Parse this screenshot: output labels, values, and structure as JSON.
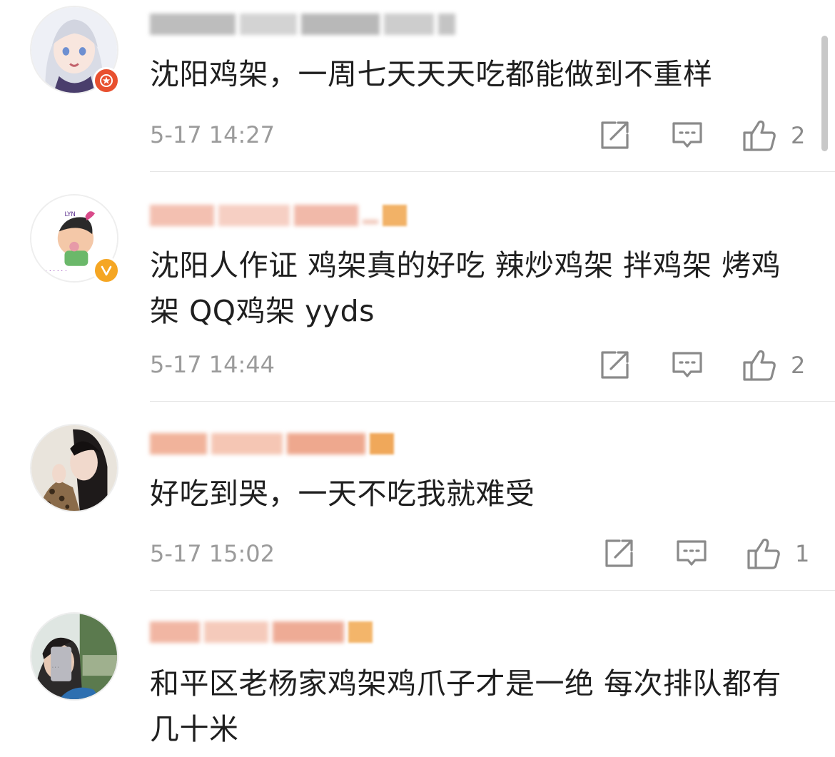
{
  "comments": [
    {
      "text": "沈阳鸡架，一周七天天天吃都能做到不重样",
      "time": "5-17 14:27",
      "likes": "2",
      "badge": {
        "type": "star-badge",
        "color": "#e8502f"
      },
      "name_colors": [
        "#bfbfbf",
        "#d2d2d2",
        "#b5b5b5"
      ]
    },
    {
      "text": "沈阳人作证 鸡架真的好吃 辣炒鸡架 拌鸡架 烤鸡架 QQ鸡架 yyds",
      "time": "5-17 14:44",
      "likes": "2",
      "badge": {
        "type": "verified-v-badge",
        "color": "#f5a623"
      },
      "name_colors": [
        "#f3c2b4",
        "#f7d2c7",
        "#f0b8a8"
      ]
    },
    {
      "text": "好吃到哭，一天不吃我就难受",
      "time": "5-17 15:02",
      "likes": "1",
      "name_colors": [
        "#f2b49c",
        "#f6c9b7",
        "#efa98e"
      ]
    },
    {
      "text": "和平区老杨家鸡架鸡爪子才是一绝 每次排队都有几十米",
      "name_colors": [
        "#f2b7a4",
        "#f6cbbc",
        "#eeab95"
      ]
    }
  ],
  "icons": {
    "share": "share-icon",
    "reply": "comment-icon",
    "like": "thumbs-up-icon"
  },
  "colors": {
    "text": "#1f1f1f",
    "meta": "#9b9b9b",
    "icon": "#8a8a8a",
    "divider": "#e5e5e5"
  }
}
